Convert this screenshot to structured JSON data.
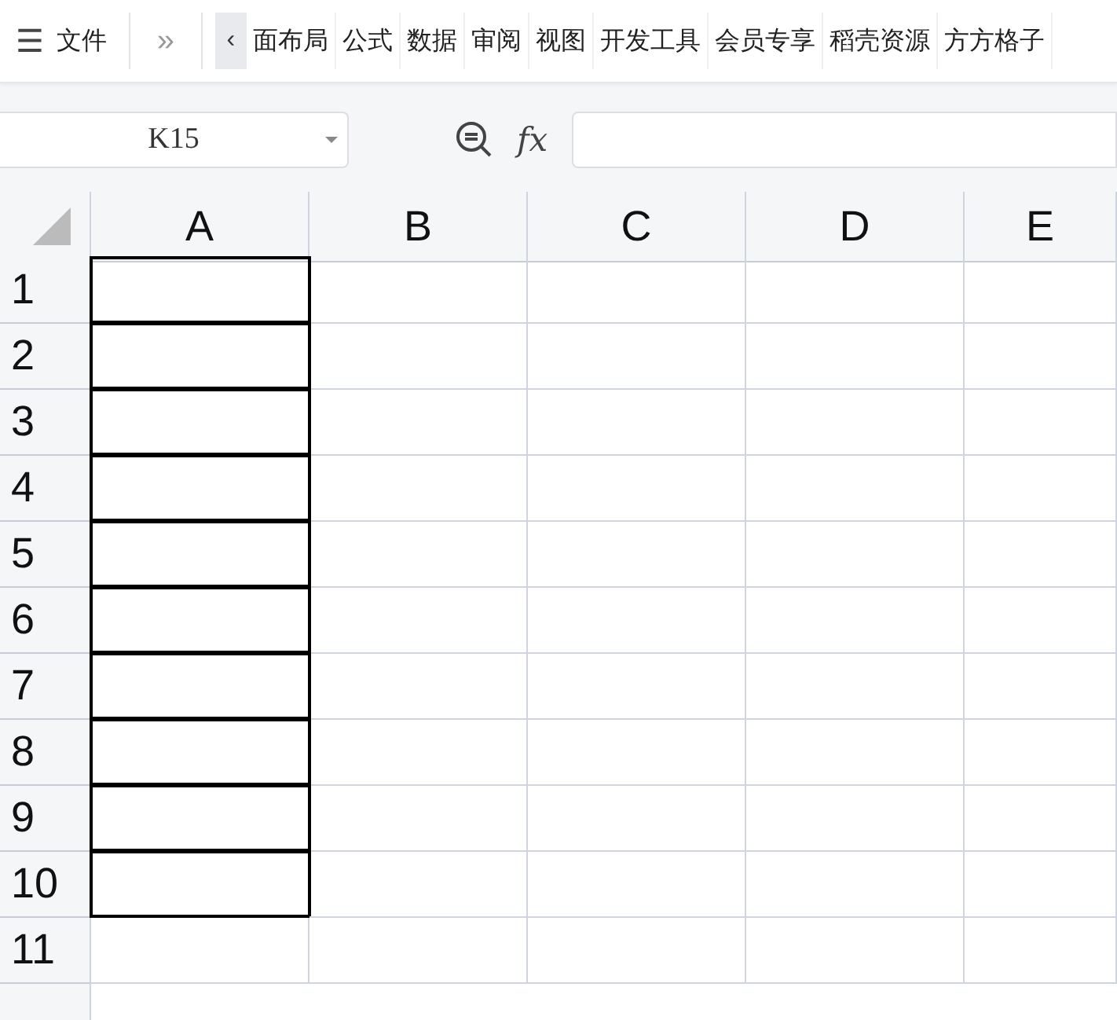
{
  "toolbar": {
    "menu_icon": "☰",
    "file_label": "文件",
    "more": "»",
    "scroll_left": "‹",
    "tabs": [
      {
        "label": "面布局"
      },
      {
        "label": "公式"
      },
      {
        "label": "数据"
      },
      {
        "label": "审阅"
      },
      {
        "label": "视图"
      },
      {
        "label": "开发工具"
      },
      {
        "label": "会员专享"
      },
      {
        "label": "稻壳资源"
      },
      {
        "label": "方方格子"
      }
    ]
  },
  "formula_bar": {
    "name_box": "K15",
    "fx": "fx"
  },
  "grid": {
    "columns": [
      "A",
      "B",
      "C",
      "D",
      "E"
    ],
    "rows": [
      {
        "label": "1",
        "bordered": true
      },
      {
        "label": "2",
        "bordered": true
      },
      {
        "label": "3",
        "bordered": true
      },
      {
        "label": "4",
        "bordered": true
      },
      {
        "label": "5",
        "bordered": true
      },
      {
        "label": "6",
        "bordered": true
      },
      {
        "label": "7",
        "bordered": true
      },
      {
        "label": "8",
        "bordered": true
      },
      {
        "label": "9",
        "bordered": true
      },
      {
        "label": "10",
        "bordered": true
      },
      {
        "label": "11",
        "bordered": false
      }
    ]
  }
}
